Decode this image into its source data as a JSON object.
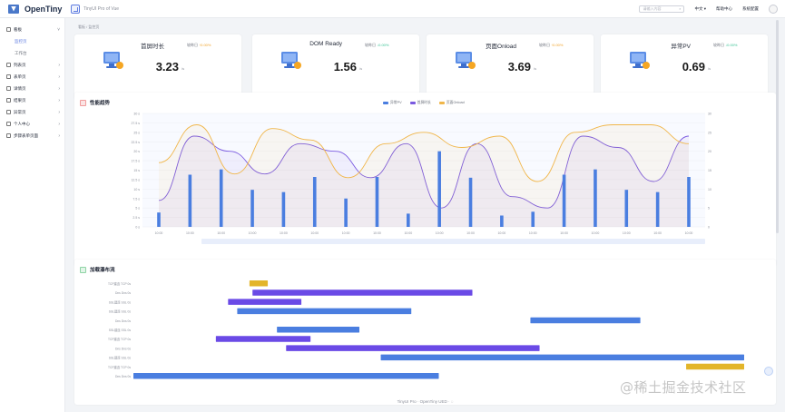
{
  "header": {
    "logo_text": "OpenTiny",
    "app_title": "TinyUI Pro of Vue",
    "search_placeholder": "请输入内容",
    "lang": "中文 ▾",
    "help": "帮助中心",
    "user": "系统配置"
  },
  "sidebar": {
    "items": [
      {
        "label": "看板",
        "expanded": true
      },
      {
        "label": "监控页",
        "sub": true,
        "active": true
      },
      {
        "label": "工作台",
        "sub": true
      },
      {
        "label": "列表页"
      },
      {
        "label": "表单页"
      },
      {
        "label": "详情页"
      },
      {
        "label": "结果页"
      },
      {
        "label": "异常页"
      },
      {
        "label": "个人中心"
      },
      {
        "label": "步骤表单页面"
      }
    ]
  },
  "breadcrumb": "看板 / 监控页",
  "kpis": [
    {
      "name": "首屏时长",
      "compare": "较昨日",
      "delta": "↑0.00%",
      "delta_color": "orange",
      "value": "3.23",
      "unit": "/s",
      "icon": "monitor-icon",
      "accent": "#4a78c9"
    },
    {
      "name": "DOM Ready",
      "compare": "较昨日",
      "delta": "↓0.00%",
      "delta_color": "green",
      "value": "1.56",
      "unit": "/s",
      "icon": "chart-icon",
      "accent": "#4a78c9"
    },
    {
      "name": "页面Onload",
      "compare": "较昨日",
      "delta": "↑0.00%",
      "delta_color": "orange",
      "value": "3.69",
      "unit": "/s",
      "icon": "trend-icon",
      "accent": "#4a78c9"
    },
    {
      "name": "异常PV",
      "compare": "较昨日",
      "delta": "↓0.00%",
      "delta_color": "green",
      "value": "0.69",
      "unit": "/s",
      "icon": "monitor-icon",
      "accent": "#4a78c9"
    }
  ],
  "perf_panel": {
    "title": "性能趋势"
  },
  "waterfall_panel": {
    "title": "加载瀑布流"
  },
  "chart_data": [
    {
      "type": "bar",
      "title": "性能趋势",
      "legend_position": "top",
      "grid": true,
      "categories": [
        "10:00",
        "10:00",
        "10:00",
        "10:00",
        "10:00",
        "10:00",
        "10:00",
        "10:00",
        "10:00",
        "10:00",
        "10:00",
        "10:00",
        "10:00",
        "10:00",
        "10:00",
        "10:00",
        "10:00",
        "10:00",
        "10:00",
        "10:00",
        "10:00",
        "10:00",
        "10:00",
        "10:00",
        "10:00",
        "10:00",
        "10:00",
        "10:00",
        "10:00"
      ],
      "ylabels_left": [
        "0 s",
        "2.5 s",
        "5 s",
        "7.5 s",
        "10 s",
        "12.5 s",
        "15 s",
        "17.5 s",
        "20 s",
        "22.5 s",
        "25 s",
        "27.5 s",
        "30 s"
      ],
      "ylabels_right": [
        "0",
        "5",
        "10",
        "15",
        "20",
        "25",
        "30"
      ],
      "series": [
        {
          "name": "异常PV",
          "type": "bar",
          "color": "#4a7ee0",
          "values": [
            3.8,
            13.8,
            15.2,
            9.8,
            9.2,
            13.2,
            7.5,
            13.2,
            3.5,
            20,
            13,
            3,
            4,
            13.8,
            15.2,
            9.8,
            9.2,
            13.2
          ]
        },
        {
          "name": "首屏时长",
          "type": "line",
          "color": "#7a5ae0",
          "values": [
            7,
            24,
            20,
            14,
            22,
            20,
            13,
            22,
            5,
            22,
            8,
            5,
            24,
            21,
            12,
            24
          ]
        },
        {
          "name": "页面Onload",
          "type": "line",
          "color": "#f0b64a",
          "values": [
            17,
            27,
            14,
            26,
            23,
            13,
            22,
            25,
            21,
            24,
            12,
            25,
            27,
            27,
            22
          ]
        }
      ]
    },
    {
      "type": "bar",
      "title": "加载瀑布流",
      "orientation": "horizontal",
      "categories": [
        "TCP建连  TCP  0s",
        "Dns  Dns  0s",
        "SSL建连  SSL  0s",
        "SSL建连  SSL  0s",
        "Dns  Dns  0s",
        "SSL建连  SSL  0s",
        "TCP建连  TCP  0s",
        "Dns  Dns  0s",
        "SSL建连  SSL  0s",
        "TCP建连  TCP  0s",
        "Dns  Dns  0s"
      ],
      "series": [
        {
          "name": "waterfall",
          "values": [
            {
              "start": 0.19,
              "end": 0.22,
              "color": "#e3b52a"
            },
            {
              "start": 0.195,
              "end": 0.555,
              "color": "#6a4ae6"
            },
            {
              "start": 0.155,
              "end": 0.275,
              "color": "#6a4ae6"
            },
            {
              "start": 0.17,
              "end": 0.455,
              "color": "#4a7ee0"
            },
            {
              "start": 0.65,
              "end": 0.83,
              "color": "#4a7ee0"
            },
            {
              "start": 0.235,
              "end": 0.37,
              "color": "#4a7ee0"
            },
            {
              "start": 0.135,
              "end": 0.29,
              "color": "#6a4ae6"
            },
            {
              "start": 0.25,
              "end": 0.665,
              "color": "#6a4ae6"
            },
            {
              "start": 0.405,
              "end": 1.0,
              "color": "#4a7ee0"
            },
            {
              "start": 0.905,
              "end": 1.0,
              "color": "#e3b52a"
            },
            {
              "start": 0.0,
              "end": 0.5,
              "color": "#4a7ee0"
            }
          ]
        }
      ]
    }
  ],
  "footer": "TinyUI Pro  ·  OpenTiny UED  ·  ◌",
  "watermark": "@稀土掘金技术社区"
}
